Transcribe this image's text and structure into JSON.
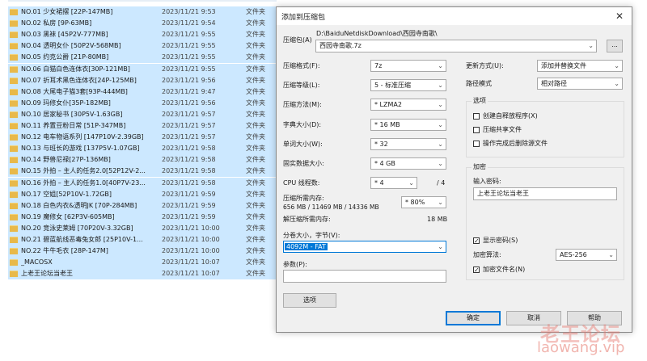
{
  "files": [
    {
      "name": "NO.01 少女裙摆 [22P-147MB]",
      "date": "2023/11/21 9:53",
      "type": "文件夹"
    },
    {
      "name": "NO.02 私房 [9P-63MB]",
      "date": "2023/11/21 9:54",
      "type": "文件夹"
    },
    {
      "name": "NO.03 黑袜 [45P2V-777MB]",
      "date": "2023/11/21 9:55",
      "type": "文件夹"
    },
    {
      "name": "NO.04 透明女仆 [50P2V-568MB]",
      "date": "2023/11/21 9:55",
      "type": "文件夹"
    },
    {
      "name": "NO.05 约克公爵 [21P-80MB]",
      "date": "2023/11/21 9:55",
      "type": "文件夹"
    },
    {
      "name": "NO.06 白猫白色连体衣[30P-121MB]",
      "date": "2023/11/21 9:55",
      "type": "文件夹"
    },
    {
      "name": "NO.07 折耳术黑色连体衣[24P-125MB]",
      "date": "2023/11/21 9:56",
      "type": "文件夹"
    },
    {
      "name": "NO.08 大尾电子猫3套[93P-444MB]",
      "date": "2023/11/21 9:47",
      "type": "文件夹"
    },
    {
      "name": "NO.09 玛修女仆[35P-182MB]",
      "date": "2023/11/21 9:56",
      "type": "文件夹"
    },
    {
      "name": "NO.10 居家秘书 [30P5V-1.63GB]",
      "date": "2023/11/21 9:57",
      "type": "文件夹"
    },
    {
      "name": "NO.11 养置豆粉日常 [51P-347MB]",
      "date": "2023/11/21 9:57",
      "type": "文件夹"
    },
    {
      "name": "NO.12 电车物语系列 [147P10V-2.39GB]",
      "date": "2023/11/21 9:57",
      "type": "文件夹"
    },
    {
      "name": "NO.13 与班长的游戏 [137P5V-1.07GB]",
      "date": "2023/11/21 9:58",
      "type": "文件夹"
    },
    {
      "name": "NO.14 野兽尼禄[27P-136MB]",
      "date": "2023/11/21 9:58",
      "type": "文件夹"
    },
    {
      "name": "NO.15 外拍 – 主人的任务2.0[52P12V-2...",
      "date": "2023/11/21 9:58",
      "type": "文件夹"
    },
    {
      "name": "NO.16 外拍 – 主人的任务1.0[40P7V-23...",
      "date": "2023/11/21 9:58",
      "type": "文件夹"
    },
    {
      "name": "NO.17 空姐[52P10V-1.72GB]",
      "date": "2023/11/21 9:59",
      "type": "文件夹"
    },
    {
      "name": "NO.18 白色内衣&透明JK [70P-284MB]",
      "date": "2023/11/21 9:59",
      "type": "文件夹"
    },
    {
      "name": "NO.19 魔修女 [62P3V-605MB]",
      "date": "2023/11/21 9:59",
      "type": "文件夹"
    },
    {
      "name": "NO.20 竞泳史莱姆 [70P20V-3.32GB]",
      "date": "2023/11/21 10:00",
      "type": "文件夹"
    },
    {
      "name": "NO.21 碧蓝航线恶毒兔女郎 [25P10V-1...",
      "date": "2023/11/21 10:00",
      "type": "文件夹"
    },
    {
      "name": "NO.22 牛牛毛衣 [28P-147M]",
      "date": "2023/11/21 10:00",
      "type": "文件夹"
    },
    {
      "name": "_MACOSX",
      "date": "2023/11/21 10:07",
      "type": "文件夹"
    },
    {
      "name": "上老王论坛当老王",
      "date": "2023/11/21 10:07",
      "type": "文件夹"
    }
  ],
  "dialog": {
    "title": "添加到压缩包",
    "close_glyph": "✕",
    "archive_label": "压缩包(A)",
    "archive_dir": "D:\\BaiduNetdiskDownload\\西园寺南歌\\",
    "archive_name": "西园寺南歌.7z",
    "browse_label": "...",
    "format_label": "压缩格式(F):",
    "format_value": "7z",
    "level_label": "压缩等级(L):",
    "level_value": "5 - 标准压缩",
    "method_label": "压缩方法(M):",
    "method_value": "* LZMA2",
    "dict_label": "字典大小(D):",
    "dict_value": "* 16 MB",
    "word_label": "单词大小(W):",
    "word_value": "* 32",
    "solid_label": "固实数据大小:",
    "solid_value": "* 4 GB",
    "threads_label": "CPU 线程数:",
    "threads_value": "* 4",
    "threads_max": "/ 4",
    "mem_comp_label": "压缩所需内存:",
    "mem_comp_value": "656 MB / 11469 MB / 14336 MB",
    "mem_pct": "* 80%",
    "mem_decomp_label": "解压缩所需内存:",
    "mem_decomp_value": "18 MB",
    "split_label": "分卷大小，字节(V):",
    "split_value": "4092M - FAT",
    "params_label": "参数(P):",
    "params_value": "",
    "options_button": "选项",
    "update_label": "更新方式(U):",
    "update_value": "添加并替换文件",
    "path_label": "路径模式",
    "path_value": "相对路径",
    "options_group": "选项",
    "opt_sfx": "创建自释放程序(X)",
    "opt_shared": "压缩共享文件",
    "opt_delete": "操作完成后删除源文件",
    "enc_group": "加密",
    "enc_password_label": "输入密码:",
    "enc_password_value": "上老王论坛当老王",
    "show_password": "显示密码(S)",
    "check_glyph": "✓",
    "enc_method_label": "加密算法:",
    "enc_method_value": "AES-256",
    "enc_names": "加密文件名(N)",
    "ok_button": "确定",
    "cancel_button": "取消",
    "help_button": "帮助"
  },
  "watermark": {
    "logo": "老王论坛",
    "url": "laowang.vip"
  }
}
